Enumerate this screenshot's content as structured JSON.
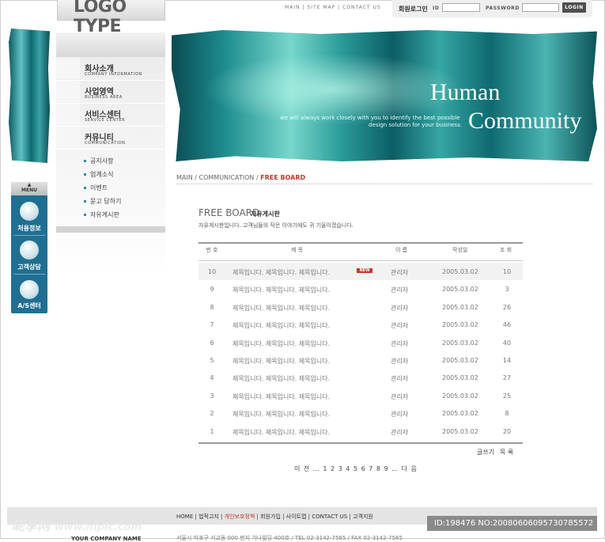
{
  "logo": "LOGO TYPE",
  "top_nav": [
    "MAIN",
    "SITE MAP",
    "CONTACT US"
  ],
  "login": {
    "title": "회원로그인",
    "id_label": "ID",
    "pw_label": "PASSWORD",
    "button": "LOGIN"
  },
  "hero": {
    "title_line1": "Human",
    "title_line2": "Community",
    "sub_line1": "we will always work closely with you to identify the best possible",
    "sub_line2": "design solution for your business."
  },
  "menu": [
    {
      "ko": "회사소개",
      "en": "COMPANY INFORMATION"
    },
    {
      "ko": "사업영역",
      "en": "BUSINESS AREA"
    },
    {
      "ko": "서비스센터",
      "en": "SERVICE CENTER"
    },
    {
      "ko": "커뮤니티",
      "en": "COMMUNICATION"
    }
  ],
  "submenu": [
    "공지사항",
    "업계소식",
    "이벤트",
    "묻고 답하기",
    "자유게시판"
  ],
  "quick": {
    "head": "MENU",
    "items": [
      "처용정보",
      "고객상담",
      "A/S센터"
    ]
  },
  "breadcrumb": {
    "home": "MAIN",
    "section": "COMMUNICATION",
    "current": "FREE BOARD"
  },
  "board": {
    "title_en": "FREE BOARD",
    "title_ko": "자유게시판",
    "desc": "자유게시판입니다. 고객님들의 작은 이야기에도 귀 기울이겠습니다.",
    "columns": [
      "번 호",
      "제 목",
      "이 름",
      "작성일",
      "조 회"
    ],
    "new_label": "NEW",
    "rows": [
      {
        "no": "10",
        "title": "제목입니다. 제목입니다. 제목입니다.",
        "name": "관리자",
        "date": "2005.03.02",
        "views": "10"
      },
      {
        "no": "9",
        "title": "제목입니다. 제목입니다. 제목입니다.",
        "name": "관리자",
        "date": "2005.03.02",
        "views": "3"
      },
      {
        "no": "8",
        "title": "제목입니다. 제목입니다. 제목입니다.",
        "name": "관리자",
        "date": "2005.03.02",
        "views": "26"
      },
      {
        "no": "7",
        "title": "제목입니다. 제목입니다. 제목입니다.",
        "name": "관리자",
        "date": "2005.03.02",
        "views": "46"
      },
      {
        "no": "6",
        "title": "제목입니다. 제목입니다. 제목입니다.",
        "name": "관리자",
        "date": "2005.03.02",
        "views": "40"
      },
      {
        "no": "5",
        "title": "제목입니다. 제목입니다. 제목입니다.",
        "name": "관리자",
        "date": "2005.03.02",
        "views": "14"
      },
      {
        "no": "4",
        "title": "제목입니다. 제목입니다. 제목입니다.",
        "name": "관리자",
        "date": "2005.03.02",
        "views": "27"
      },
      {
        "no": "3",
        "title": "제목입니다. 제목입니다. 제목입니다.",
        "name": "관리자",
        "date": "2005.03.02",
        "views": "25"
      },
      {
        "no": "2",
        "title": "제목입니다. 제목입니다. 제목입니다.",
        "name": "관리자",
        "date": "2005.03.02",
        "views": "8"
      },
      {
        "no": "1",
        "title": "제목입니다. 제목입니다. 제목입니다.",
        "name": "관리자",
        "date": "2005.03.02",
        "views": "20"
      }
    ],
    "write_label": "글쓰기",
    "list_label": "목 록",
    "pager": {
      "prev": "이 전",
      "next": "다 음",
      "pages": [
        "1",
        "2",
        "3",
        "4",
        "5",
        "6",
        "7",
        "8",
        "9"
      ]
    }
  },
  "footer": {
    "nav": [
      "HOME",
      "법적고지",
      "개인보호정책",
      "회원가입",
      "사이트맵",
      "CONTACT US",
      "고객지원"
    ],
    "id_text": "ID:198476 NO:20080606095730785572",
    "watermark": "昵享网",
    "watermark_url": "www.nipic.com",
    "company": "YOUR COMPANY NAME",
    "address": "서울시 마포구 서교동 000 번지 가나빌딩 400호 / TEL 02-3142-7565 / FAX 02-3142-7565"
  },
  "colors": {
    "accent": "#c0392b",
    "teal": "#1c8a8c",
    "quick_bg": "#1f6f93"
  }
}
